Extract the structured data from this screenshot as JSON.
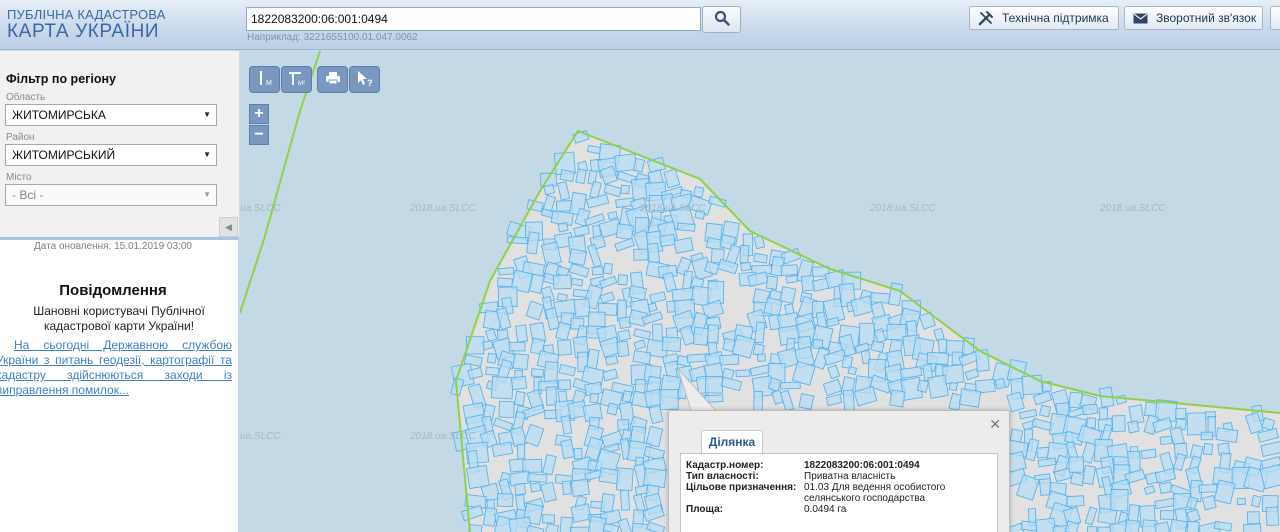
{
  "header": {
    "logo_line1": "ПУБЛІЧНА КАДАСТРОВА",
    "logo_line2": "КАРТА УКРАЇНИ",
    "search_value": "1822083200:06:001:0494",
    "search_hint": "Наприклад: 3221655100.01.047.0062",
    "support_label": "Технічна підтримка",
    "feedback_label": "Зворотний зв'язок"
  },
  "sidebar": {
    "filter_title": "Фільтр по регіону",
    "oblast_label": "Область",
    "oblast_value": "ЖИТОМИРСЬКА",
    "raion_label": "Район",
    "raion_value": "ЖИТОМИРСЬКИЙ",
    "city_label": "Місто",
    "city_value": "- Всі -",
    "update_date": "Дата оновлення: 15.01.2019 03:00",
    "notice_title": "Повідомлення",
    "notice_text": "Шановні користувачі Публічної кадастрової карти України!",
    "notice_link": "На сьогодні Державною службою України з питань геодезії, картографії та кадастру здійснюються заходи із виправлення помилок..."
  },
  "map": {
    "watermark": "2018.ua.SLCC"
  },
  "popup": {
    "tab_label": "Ділянка",
    "rows": [
      {
        "key": "Кадастр.номер:",
        "value": "1822083200:06:001:0494"
      },
      {
        "key": "Тип власності:",
        "value": "Приватна власність"
      },
      {
        "key": "Цільове призначення:",
        "value": "01.03 Для ведення особистого селянського господарства"
      },
      {
        "key": "Площа:",
        "value": "0.0494 га"
      }
    ]
  },
  "colors": {
    "map_water": "#c4d9e6",
    "settlement_fill": "#e1e1e1",
    "parcel_fill": "#b8dcf3",
    "parcel_stroke": "#5ab3ec",
    "boundary": "#8fd14b",
    "header_text": "#3a68a6",
    "toolbar_button": "#7a98bf"
  }
}
